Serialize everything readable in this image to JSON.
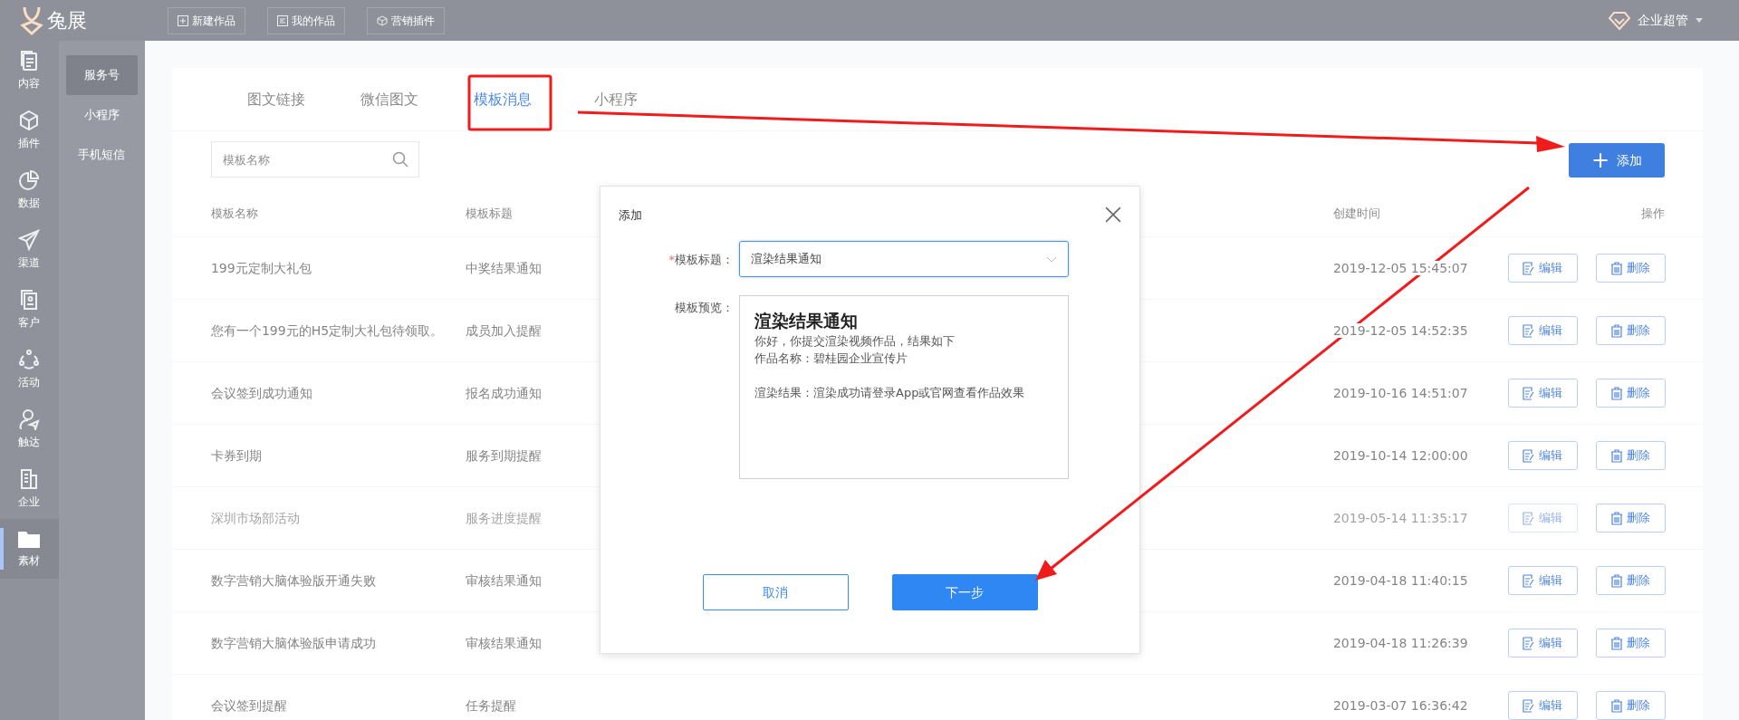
{
  "topbar": {
    "logo": "兔展",
    "nav": [
      {
        "label": "新建作品"
      },
      {
        "label": "我的作品"
      },
      {
        "label": "营销插件"
      }
    ],
    "user": "企业超管"
  },
  "sidebar": {
    "items": [
      {
        "label": "内容",
        "selected": false
      },
      {
        "label": "插件",
        "selected": false
      },
      {
        "label": "数据",
        "selected": false
      },
      {
        "label": "渠道",
        "selected": false
      },
      {
        "label": "客户",
        "selected": false
      },
      {
        "label": "活动",
        "selected": false
      },
      {
        "label": "触达",
        "selected": false
      },
      {
        "label": "企业",
        "selected": false
      },
      {
        "label": "素材",
        "selected": true
      }
    ]
  },
  "subnav": {
    "items": [
      {
        "label": "服务号",
        "selected": true
      },
      {
        "label": "小程序",
        "selected": false
      },
      {
        "label": "手机短信",
        "selected": false
      }
    ]
  },
  "tabs": [
    {
      "label": "图文链接",
      "selected": false
    },
    {
      "label": "微信图文",
      "selected": false
    },
    {
      "label": "模板消息",
      "selected": true
    },
    {
      "label": "小程序",
      "selected": false
    }
  ],
  "search": {
    "placeholder": "模板名称"
  },
  "add_button": {
    "icon": "+",
    "label": "添加"
  },
  "table": {
    "columns": [
      "模板名称",
      "模板标题",
      "创建时间",
      "操作"
    ],
    "rows": [
      {
        "name": "199元定制大礼包",
        "title": "中奖结果通知",
        "created": "2019-12-05 15:45:07",
        "disabled": false,
        "actions": [
          "编辑",
          "删除"
        ]
      },
      {
        "name": "您有一个199元的H5定制大礼包待领取。",
        "title": "成员加入提醒",
        "created": "2019-12-05 14:52:35",
        "disabled": false,
        "actions": [
          "编辑",
          "删除"
        ]
      },
      {
        "name": "会议签到成功通知",
        "title": "报名成功通知",
        "created": "2019-10-16 14:51:07",
        "disabled": false,
        "actions": [
          "编辑",
          "删除"
        ]
      },
      {
        "name": "卡券到期",
        "title": "服务到期提醒",
        "created": "2019-10-14 12:00:00",
        "disabled": false,
        "actions": [
          "编辑",
          "删除"
        ]
      },
      {
        "name": "深圳市场部活动",
        "title": "服务进度提醒",
        "created": "2019-05-14 11:35:17",
        "disabled": true,
        "actions": [
          "编辑",
          "删除"
        ]
      },
      {
        "name": "数字营销大脑体验版开通失败",
        "title": "审核结果通知",
        "created": "2019-04-18 11:40:15",
        "disabled": false,
        "actions": [
          "编辑",
          "删除"
        ]
      },
      {
        "name": "数字营销大脑体验版申请成功",
        "title": "审核结果通知",
        "created": "2019-04-18 11:26:39",
        "disabled": false,
        "actions": [
          "编辑",
          "删除"
        ]
      },
      {
        "name": "会议签到提醒",
        "title": "任务提醒",
        "created": "2019-03-07 16:36:42",
        "disabled": false,
        "actions": [
          "编辑",
          "删除"
        ]
      }
    ]
  },
  "modal": {
    "title": "添加",
    "fields": [
      {
        "kind": "select",
        "label": "模板标题：",
        "required_mark": "*",
        "value": "渲染结果通知"
      },
      {
        "kind": "preview",
        "label": "模板预览：",
        "heading": "渲染结果通知",
        "lines": [
          "你好，你提交渲染视频作品，结果如下",
          "作品名称：碧桂园企业宣传片",
          "渲染结果：渲染成功请登录App或官网查看作品效果"
        ]
      }
    ],
    "buttons": [
      {
        "label": "取消",
        "kind": "secondary"
      },
      {
        "label": "下一步",
        "kind": "primary"
      }
    ]
  }
}
